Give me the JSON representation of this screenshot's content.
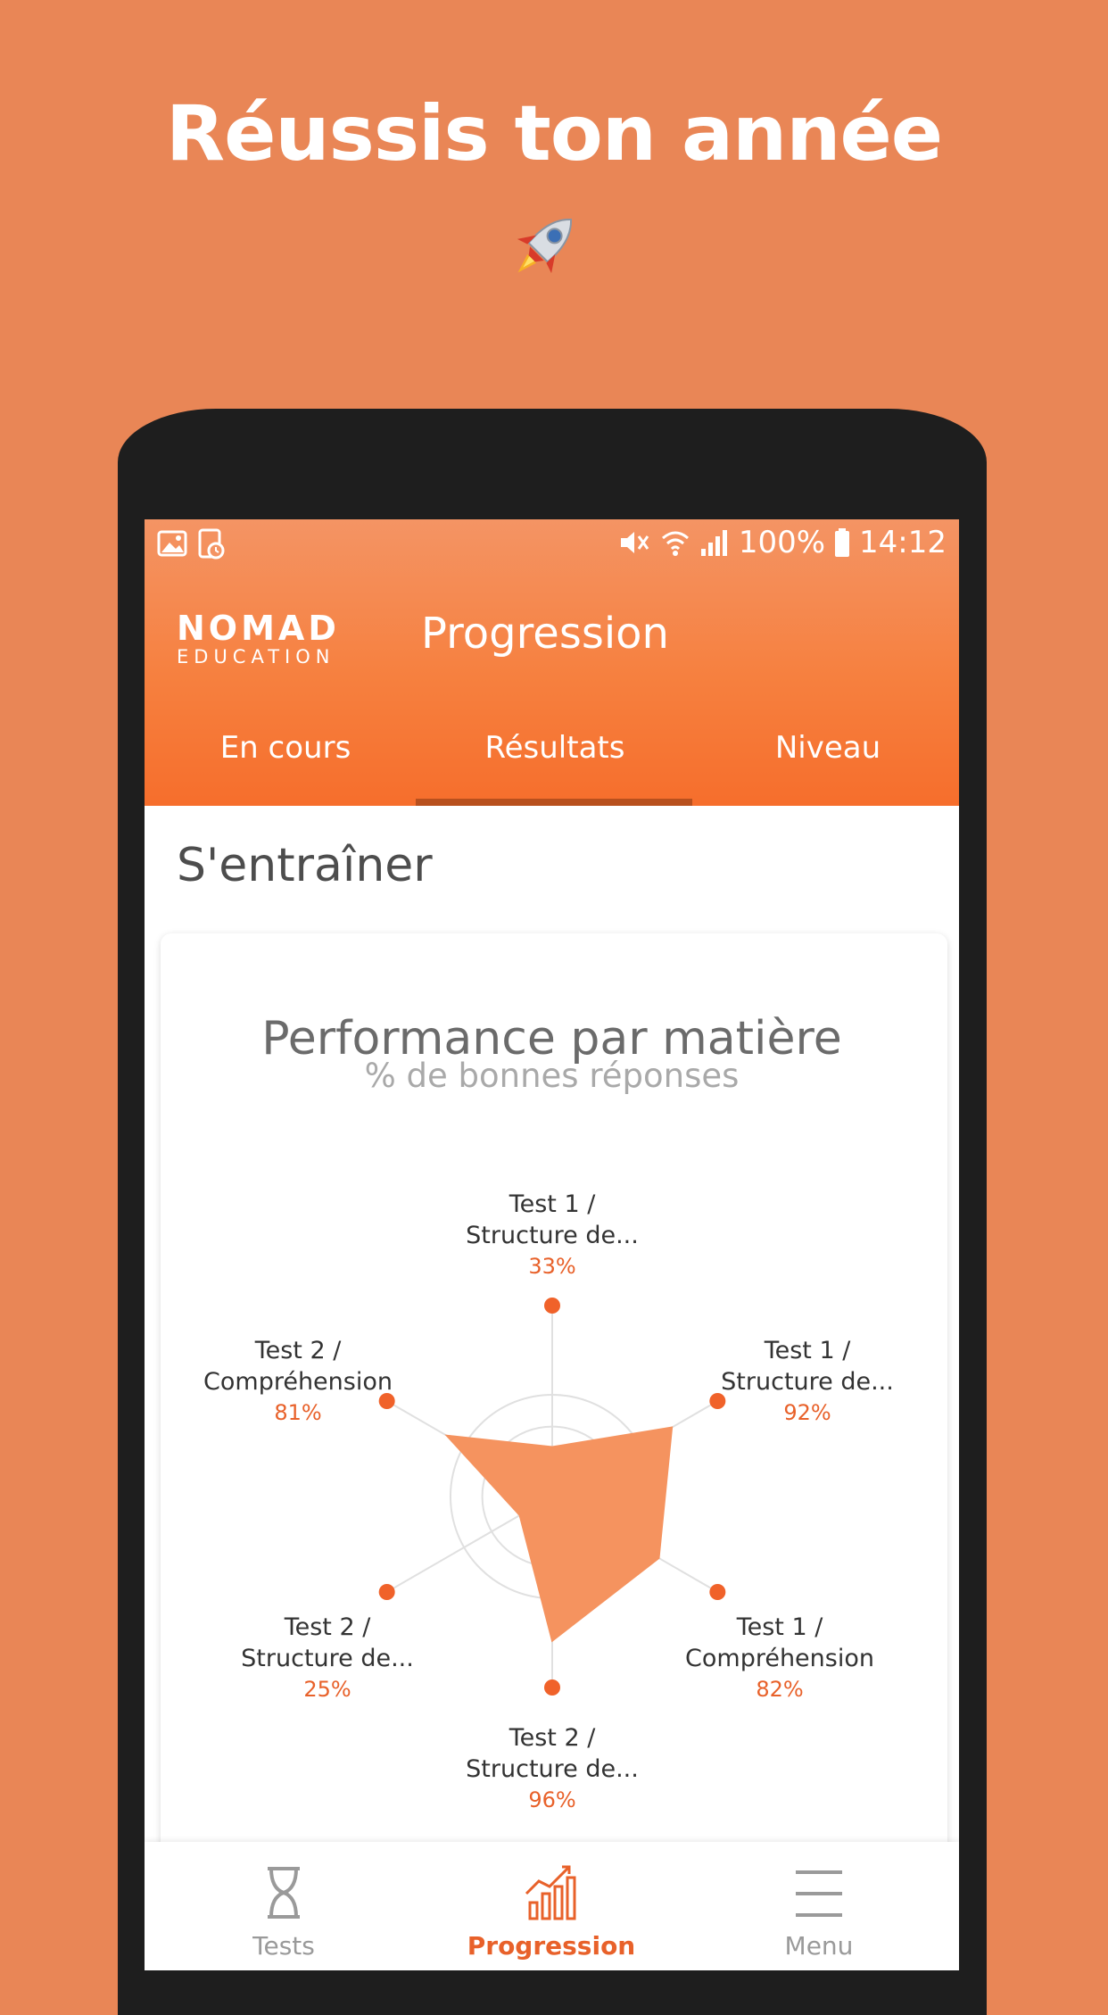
{
  "headline": "Réussis ton année",
  "status_bar": {
    "battery": "100%",
    "time": "14:12"
  },
  "app": {
    "logo_top": "NOMAD",
    "logo_bottom": "EDUCATION",
    "title": "Progression",
    "tabs": [
      {
        "label": "En cours",
        "active": false
      },
      {
        "label": "Résultats",
        "active": true
      },
      {
        "label": "Niveau",
        "active": false
      }
    ],
    "section_title": "S'entraîner"
  },
  "card": {
    "title": "Performance par matière",
    "subtitle": "% de bonnes réponses"
  },
  "chart_data": {
    "type": "radar",
    "title": "Performance par matière",
    "subtitle": "% de bonnes réponses",
    "axes": [
      {
        "line1": "Test 1 /",
        "line2": "Structure de...",
        "value": 33,
        "label": "33%"
      },
      {
        "line1": "Test 1 /",
        "line2": "Structure de...",
        "value": 92,
        "label": "92%"
      },
      {
        "line1": "Test 1 /",
        "line2": "Compréhension",
        "value": 82,
        "label": "82%"
      },
      {
        "line1": "Test 2 /",
        "line2": "Structure de...",
        "value": 96,
        "label": "96%"
      },
      {
        "line1": "Test 2 /",
        "line2": "Structure de...",
        "value": 25,
        "label": "25%"
      },
      {
        "line1": "Test 2 /",
        "line2": "Compréhension",
        "value": 81,
        "label": "81%"
      }
    ],
    "fill_color": "#F5935F",
    "marker_color": "#F0622A",
    "grid": true
  },
  "bottom_nav": [
    {
      "label": "Tests",
      "icon": "hourglass-icon",
      "active": false
    },
    {
      "label": "Progression",
      "icon": "chart-icon",
      "active": true
    },
    {
      "label": "Menu",
      "icon": "menu-icon",
      "active": false
    }
  ],
  "colors": {
    "accent": "#F66E2C",
    "background": "#E98656"
  }
}
